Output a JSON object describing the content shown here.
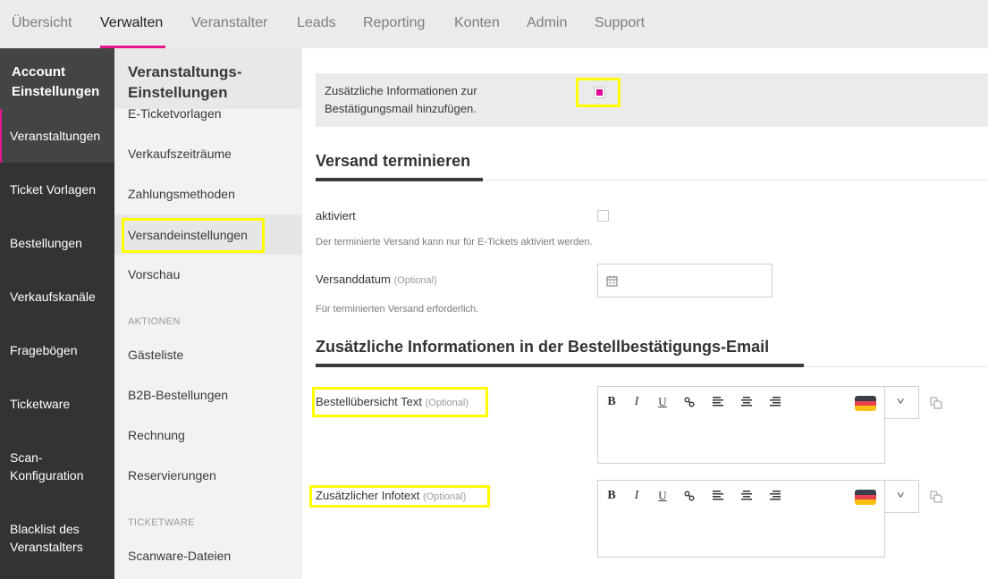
{
  "topnav": {
    "tabs": [
      {
        "label": "Übersicht",
        "active": false
      },
      {
        "label": "Verwalten",
        "active": true
      },
      {
        "label": "Veranstalter",
        "active": false
      },
      {
        "label": "Leads",
        "active": false
      },
      {
        "label": "Reporting",
        "active": false
      },
      {
        "label": "Konten",
        "active": false
      },
      {
        "label": "Admin",
        "active": false
      },
      {
        "label": "Support",
        "active": false
      }
    ]
  },
  "sidebar": {
    "title": "Account Einstellungen",
    "items": [
      {
        "label": "Veranstaltungen",
        "active": true
      },
      {
        "label": "Ticket Vorlagen"
      },
      {
        "label": "Bestellungen"
      },
      {
        "label": "Verkaufskanäle"
      },
      {
        "label": "Fragebögen"
      },
      {
        "label": "Ticketware"
      },
      {
        "label": "Scan-Konfiguration"
      },
      {
        "label": "Blacklist des Veranstalters"
      }
    ]
  },
  "subnav": {
    "title": "Veranstaltungs-Einstellungen",
    "links": [
      {
        "label": "E-Ticketvorlagen"
      },
      {
        "label": "Verkaufszeiträume"
      },
      {
        "label": "Zahlungsmethoden"
      },
      {
        "label": "Versandeinstellungen",
        "active": true
      },
      {
        "label": "Vorschau"
      }
    ],
    "section_actions": "AKTIONEN",
    "actions": [
      {
        "label": "Gästeliste"
      },
      {
        "label": "B2B-Bestellungen"
      },
      {
        "label": "Rechnung"
      },
      {
        "label": "Reservierungen"
      }
    ],
    "section_ticketware": "TICKETWARE",
    "ticketware": [
      {
        "label": "Scanware-Dateien"
      }
    ]
  },
  "main": {
    "infobox": {
      "text_line1": "Zusätzliche Informationen zur",
      "text_line2": "Bestätigungsmail hinzufügen.",
      "checked": true
    },
    "versand": {
      "title": "Versand terminieren",
      "activated_label": "aktiviert",
      "activated_checked": false,
      "activated_hint": "Der terminierte Versand kann nur für E-Tickets aktiviert werden.",
      "date_label": "Versanddatum",
      "date_optional": "(Optional)",
      "date_value": "",
      "date_hint": "Für terminierten Versand erforderlich."
    },
    "extra": {
      "title": "Zusätzliche Informationen in der Bestellbestätigungs-Email",
      "fields": [
        {
          "label": "Bestellübersicht Text",
          "optional": "(Optional)",
          "value": "",
          "language": "de"
        },
        {
          "label": "Zusätzlicher Infotext",
          "optional": "(Optional)",
          "value": "",
          "language": "de"
        }
      ],
      "toolbar": {
        "bold": "B",
        "italic": "I",
        "underline": "U",
        "dropdown": "v"
      }
    }
  },
  "colors": {
    "accent": "#e6168c",
    "checkbox_fill": "#e6009a",
    "highlight": "#ffff00",
    "sidebar_dark": "#333333",
    "sidebar_active": "#444444"
  }
}
